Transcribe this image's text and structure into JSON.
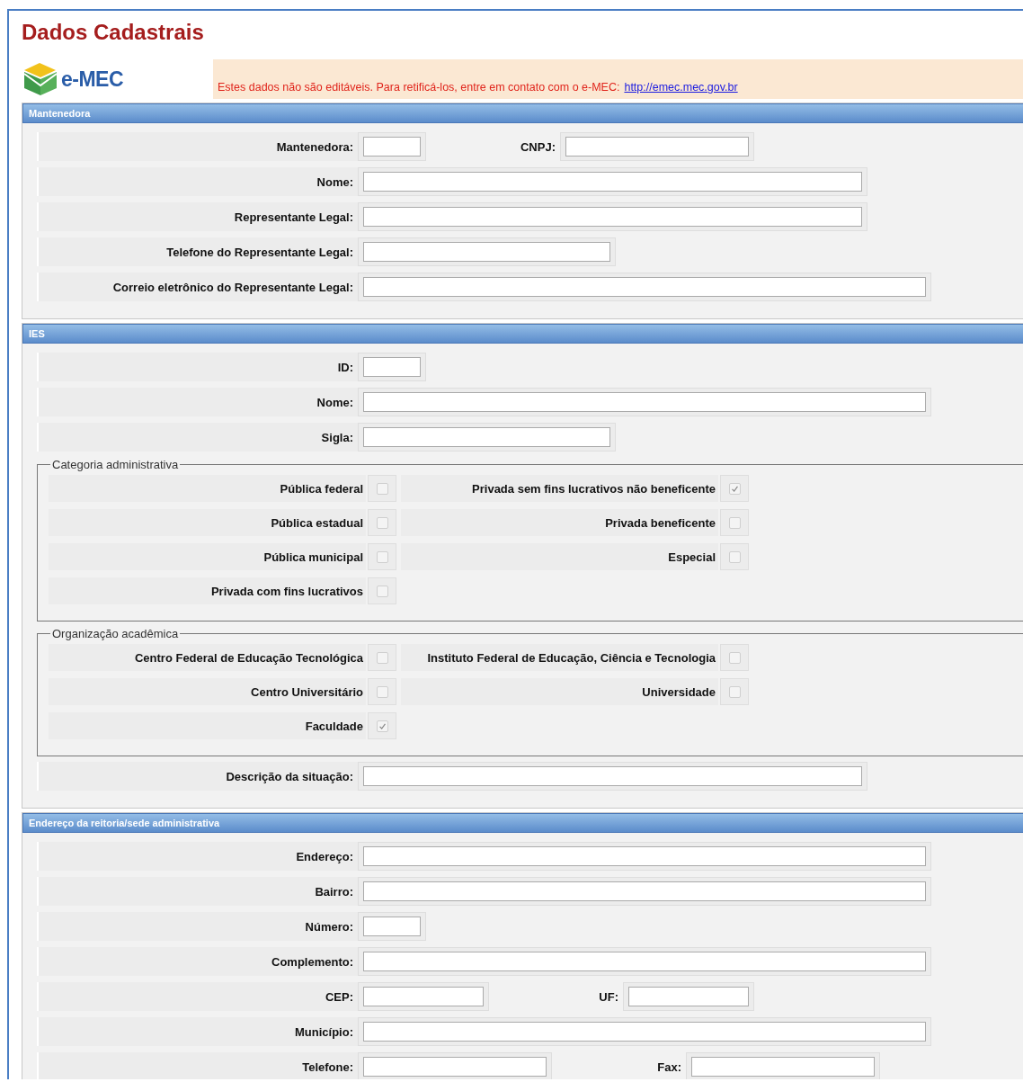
{
  "title": "Dados Cadastrais",
  "logo": {
    "text": "e-MEC"
  },
  "notice": {
    "text": "Estes dados não são editáveis. Para retificá-los, entre em contato com o e-MEC:",
    "link": "http://emec.mec.gov.br"
  },
  "sections": [
    {
      "title": "Mantenedora",
      "items": [
        {
          "kind": "fields",
          "fields": [
            {
              "label": "Mantenedora:",
              "kind": "tiny"
            },
            {
              "label": "CNPJ:",
              "kind": "compact"
            }
          ]
        },
        {
          "kind": "fields",
          "fields": [
            {
              "label": "Nome:",
              "kind": "long"
            }
          ]
        },
        {
          "kind": "fields",
          "fields": [
            {
              "label": "Representante Legal:",
              "kind": "long"
            }
          ]
        },
        {
          "kind": "fields",
          "fields": [
            {
              "label": "Telefone do Representante Legal:",
              "kind": "medium"
            }
          ]
        },
        {
          "kind": "fields",
          "fields": [
            {
              "label": "Correio eletrônico do Representante Legal:",
              "kind": "wide"
            }
          ]
        }
      ]
    },
    {
      "title": "IES",
      "items": [
        {
          "kind": "fields",
          "fields": [
            {
              "label": "ID:",
              "kind": "tiny"
            }
          ]
        },
        {
          "kind": "fields",
          "fields": [
            {
              "label": "Nome:",
              "kind": "wide"
            }
          ]
        },
        {
          "kind": "fields",
          "fields": [
            {
              "label": "Sigla:",
              "kind": "medium"
            }
          ]
        },
        {
          "kind": "checks",
          "legend": "Categoria administrativa",
          "rows": [
            [
              {
                "label": "Pública federal",
                "checked": false
              },
              {
                "label": "Privada sem fins lucrativos não beneficente",
                "checked": true
              }
            ],
            [
              {
                "label": "Pública estadual",
                "checked": false
              },
              {
                "label": "Privada beneficente",
                "checked": false
              }
            ],
            [
              {
                "label": "Pública municipal",
                "checked": false
              },
              {
                "label": "Especial",
                "checked": false
              }
            ],
            [
              {
                "label": "Privada com fins lucrativos",
                "checked": false
              }
            ]
          ]
        },
        {
          "kind": "checks",
          "legend": "Organização acadêmica",
          "rows": [
            [
              {
                "label": "Centro Federal de Educação Tecnológica",
                "checked": false
              },
              {
                "label": "Instituto Federal de Educação, Ciência e Tecnologia",
                "checked": false
              }
            ],
            [
              {
                "label": "Centro Universitário",
                "checked": false
              },
              {
                "label": "Universidade",
                "checked": false
              }
            ],
            [
              {
                "label": "Faculdade",
                "checked": true
              }
            ]
          ]
        },
        {
          "kind": "fields",
          "fields": [
            {
              "label": "Descrição da situação:",
              "kind": "long"
            }
          ]
        }
      ]
    },
    {
      "title": "Endereço da reitoria/sede administrativa",
      "items": [
        {
          "kind": "fields",
          "fields": [
            {
              "label": "Endereço:",
              "kind": "wide"
            }
          ]
        },
        {
          "kind": "fields",
          "fields": [
            {
              "label": "Bairro:",
              "kind": "wide"
            }
          ]
        },
        {
          "kind": "fields",
          "fields": [
            {
              "label": "Número:",
              "kind": "tiny"
            }
          ]
        },
        {
          "kind": "fields",
          "fields": [
            {
              "label": "Complemento:",
              "kind": "wide"
            }
          ]
        },
        {
          "kind": "fields",
          "fields": [
            {
              "label": "CEP:",
              "kind": "short"
            },
            {
              "label": "UF:",
              "kind": "short"
            }
          ]
        },
        {
          "kind": "fields",
          "fields": [
            {
              "label": "Município:",
              "kind": "wide"
            }
          ]
        },
        {
          "kind": "fields",
          "fields": [
            {
              "label": "Telefone:",
              "kind": "compact"
            },
            {
              "label": "Fax:",
              "kind": "compact"
            }
          ]
        }
      ]
    }
  ]
}
